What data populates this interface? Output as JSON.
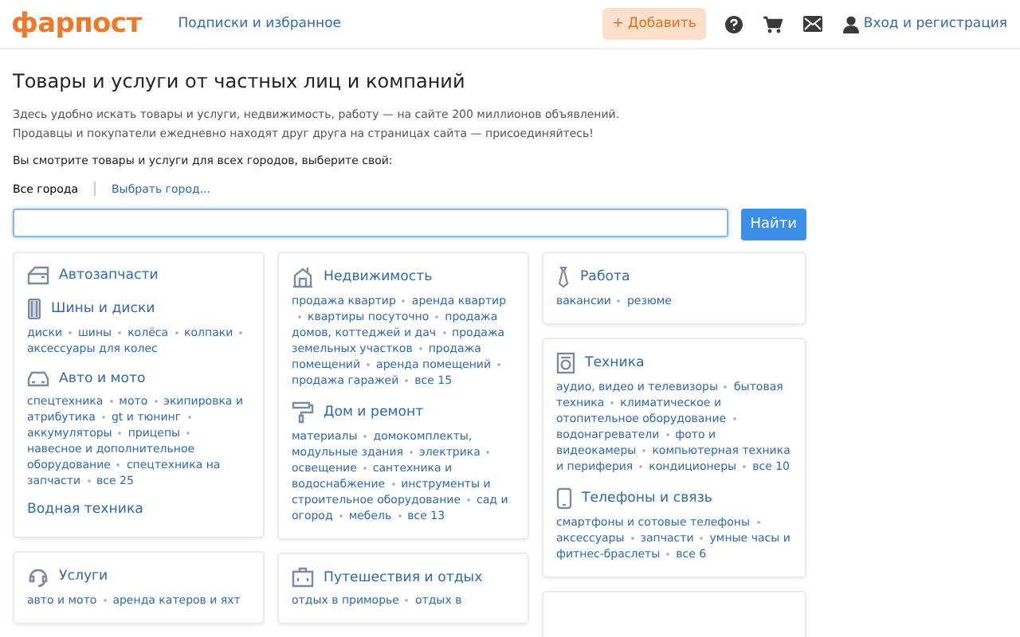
{
  "header": {
    "logo": "фарпост",
    "subscriptions_link": "Подписки и избранное",
    "add_button": "+ Добавить",
    "login_link": "Вход и регистрация"
  },
  "heading": "Товары и услуги от частных лиц и компаний",
  "description": [
    "Здесь удобно искать товары и услуги, недвижимость, работу — на сайте 200 миллионов объявлений.",
    "Продавцы и покупатели ежедневно находят друг друга на страницах сайта — присоединяйтесь!"
  ],
  "city_prompt": "Вы смотрите товары и услуги для всех городов, выберите свой:",
  "city_filter": {
    "current": "Все города",
    "choose_link": "Выбрать город..."
  },
  "search": {
    "button": "Найти"
  },
  "columns": [
    [
      {
        "sections": [
          {
            "kind": "door",
            "title": "Автозапчасти"
          },
          {
            "kind": "tire",
            "title": "Шины и диски",
            "links": [
              "диски",
              "шины",
              "колёса",
              "колпаки",
              "аксессуары для колес"
            ]
          },
          {
            "kind": "car",
            "title": "Авто и мото",
            "links": [
              "спецтехника",
              "мото",
              "экипировка и атрибутика",
              "gt и тюнинг",
              "аккумуляторы",
              "прицепы",
              "навесное и дополнительное оборудование",
              "спецтехника на запчасти",
              "все 25"
            ]
          },
          {
            "kind": "plain",
            "title": "Водная техника"
          }
        ]
      },
      {
        "sections": [
          {
            "kind": "headset",
            "title": "Услуги",
            "links": [
              "авто и мото",
              "аренда катеров и яхт"
            ]
          }
        ]
      }
    ],
    [
      {
        "sections": [
          {
            "kind": "building",
            "title": "Недвижимость",
            "links": [
              "продажа квартир",
              "аренда квартир",
              "квартиры посуточно",
              "продажа домов, коттеджей и дач",
              "продажа земельных участков",
              "продажа помещений",
              "аренда помещений",
              "продажа гаражей",
              "все 15"
            ]
          },
          {
            "kind": "roller",
            "title": "Дом и ремонт",
            "links": [
              "материалы",
              "домокомплекты, модульные здания",
              "электрика",
              "освещение",
              "сантехника и водоснабжение",
              "инструменты и строительное оборудование",
              "сад и огород",
              "мебель",
              "все 13"
            ]
          }
        ]
      },
      {
        "sections": [
          {
            "kind": "suitcase",
            "title": "Путешествия и отдых",
            "links": [
              "отдых в приморье",
              "отдых в"
            ]
          }
        ]
      }
    ],
    [
      {
        "sections": [
          {
            "kind": "tie",
            "title": "Работа",
            "links": [
              "вакансии",
              "резюме"
            ]
          }
        ]
      },
      {
        "sections": [
          {
            "kind": "washer",
            "title": "Техника",
            "links": [
              "аудио, видео и телевизоры",
              "бытовая техника",
              "климатическое и отопительное оборудование",
              "водонагреватели",
              "фото и видеокамеры",
              "компьютерная техника и периферия",
              "кондиционеры",
              "все 10"
            ]
          },
          {
            "kind": "phone",
            "title": "Телефоны и связь",
            "links": [
              "смартфоны и сотовые телефоны",
              "аксессуары",
              "запчасти",
              "умные часы и фитнес-браслеты",
              "все 6"
            ]
          }
        ]
      },
      {}
    ]
  ]
}
